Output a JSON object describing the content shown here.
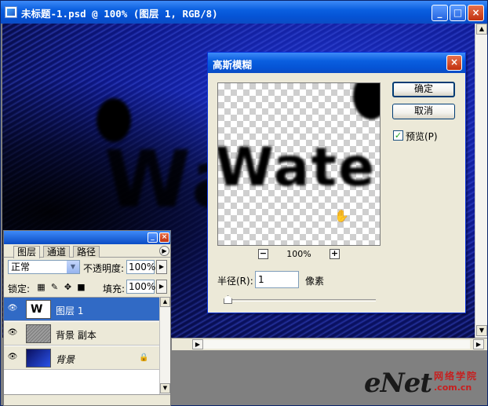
{
  "document": {
    "title": "未标题-1.psd @ 100% (图层 1, RGB/8)",
    "canvas_text": "Wate",
    "window_buttons": [
      "_",
      "□",
      "×"
    ]
  },
  "dialog": {
    "title": "高斯模糊",
    "preview_text": "Wate",
    "ok": "确定",
    "cancel": "取消",
    "preview_label": "预览(P)",
    "preview_checked": true,
    "zoom_level": "100%",
    "zoom_out": "−",
    "zoom_in": "+",
    "radius_label": "半径(R):",
    "radius_value": "1",
    "radius_unit": "像素"
  },
  "layers_panel": {
    "tabs": [
      "图层",
      "通道",
      "路径"
    ],
    "blend_mode": "正常",
    "opacity_label": "不透明度:",
    "opacity": "100%",
    "lock_label": "锁定:",
    "fill_label": "填充:",
    "fill": "100%",
    "layers": [
      {
        "name": "图层 1",
        "selected": true
      },
      {
        "name": "背景 副本",
        "selected": false
      },
      {
        "name": "背景",
        "selected": false,
        "locked": true
      }
    ]
  },
  "watermark": {
    "brand": "eNet",
    "cn": "网络学院",
    "domain": ".com.cn"
  },
  "colors": {
    "titlebar": "#0a5fe0",
    "selection": "#316ac5",
    "dialog_bg": "#ece9d8",
    "watermark_red": "#c81e1e"
  }
}
